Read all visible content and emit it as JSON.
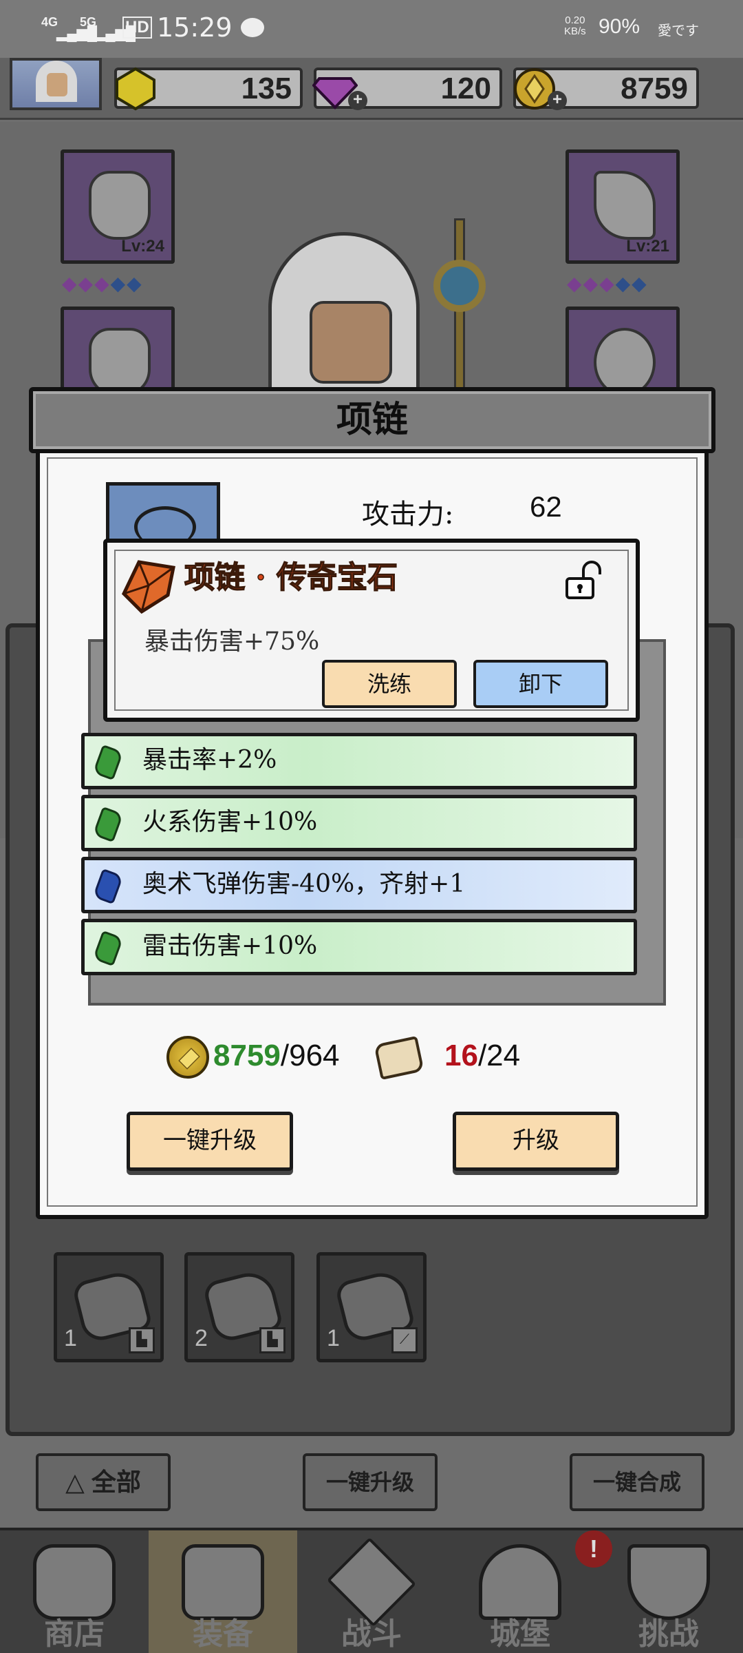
{
  "status_bar": {
    "network_1": "4G",
    "network_2": "5G",
    "hd": "HD",
    "time": "15:29",
    "speed_value": "0.20",
    "speed_unit": "KB/s",
    "battery": "90%",
    "carrier": "愛です"
  },
  "resources": {
    "gold_gem": "135",
    "diamond": "120",
    "coins": "8759"
  },
  "equipment": {
    "helmet_level": "Lv:24",
    "weapon_level": "Lv:21"
  },
  "dialog": {
    "title": "项链",
    "stat_label": "攻击力:",
    "stat_value": "62"
  },
  "gem_popup": {
    "title": "项链 · 传奇宝石",
    "description": "暴击伤害+75%",
    "reforge_button": "洗练",
    "unequip_button": "卸下"
  },
  "affixes": [
    {
      "text": "暴击率+2%",
      "rarity": "green"
    },
    {
      "text": "火系伤害+10%",
      "rarity": "green"
    },
    {
      "text": "奥术飞弹伤害-40%，齐射+1",
      "rarity": "blue"
    },
    {
      "text": "雷击伤害+10%",
      "rarity": "green"
    }
  ],
  "upgrade_cost": {
    "coins_owned": "8759",
    "coins_required": "/964",
    "scrolls_owned": "16",
    "scrolls_required": "/24"
  },
  "dialog_buttons": {
    "one_click_upgrade": "一键升级",
    "upgrade": "升级"
  },
  "materials": [
    {
      "count": "1"
    },
    {
      "count": "2"
    },
    {
      "count": "1"
    }
  ],
  "background_buttons": {
    "all": "全部",
    "one_click_upgrade": "一键升级",
    "one_click_merge": "一键合成"
  },
  "nav": {
    "shop": "商店",
    "equipment": "装备",
    "battle": "战斗",
    "castle": "城堡",
    "challenge": "挑战",
    "alert_badge": "!"
  },
  "colors": {
    "coin_owned_color": "#2e8b2e",
    "scroll_owned_color": "#b3121c",
    "gem_title_color": "#d4461a",
    "green_affix": "#c9eec9",
    "blue_affix": "#c2d8f6"
  }
}
